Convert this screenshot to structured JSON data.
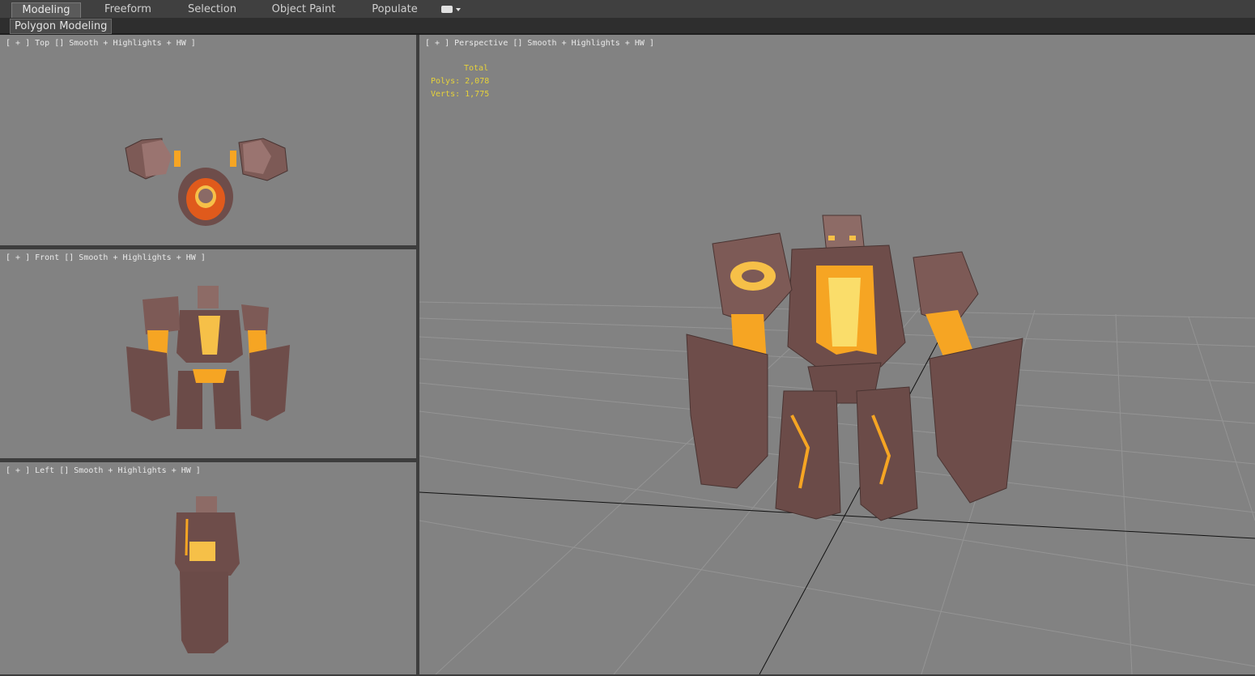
{
  "ribbon": {
    "tabs": [
      {
        "label": "Modeling",
        "active": true
      },
      {
        "label": "Freeform",
        "active": false
      },
      {
        "label": "Selection",
        "active": false
      },
      {
        "label": "Object Paint",
        "active": false
      },
      {
        "label": "Populate",
        "active": false
      }
    ],
    "panel_label": "Polygon Modeling",
    "dropdown_icon": "ribbon-options-icon"
  },
  "viewports": {
    "top": {
      "label": "[ + ] Top [] Smooth + Highlights + HW ]"
    },
    "front": {
      "label": "[ + ] Front [] Smooth + Highlights + HW ]"
    },
    "left": {
      "label": "[ + ] Left [] Smooth + Highlights + HW ]"
    },
    "perspective": {
      "label": "[ + ] Perspective [] Smooth + Highlights + HW ]",
      "stats": {
        "title": "Total",
        "polys": "Polys: 2,078",
        "verts": "Verts: 1,775"
      }
    }
  },
  "colors": {
    "viewport_bg": "#828282",
    "stats_text": "#e6d23a",
    "rock": "#7a5552",
    "lava": "#f6a523"
  }
}
